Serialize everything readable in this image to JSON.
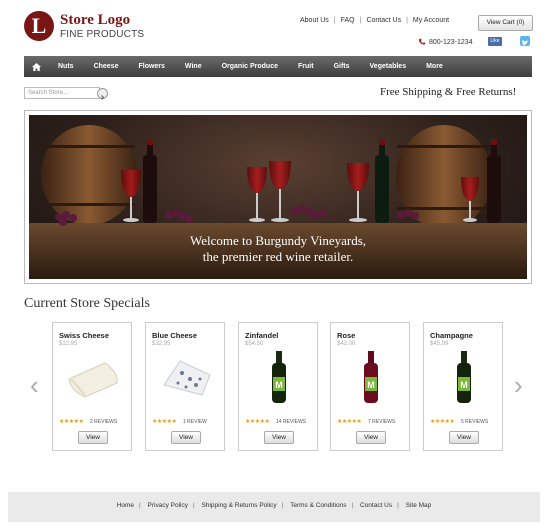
{
  "header": {
    "logo_letter": "L",
    "logo_title": "Store Logo",
    "logo_subtitle": "FINE PRODUCTS",
    "top_links": [
      "About Us",
      "FAQ",
      "Contact Us",
      "My Account"
    ],
    "cart_label": "View Cart (0)",
    "phone": "800-123-1234",
    "like_label": "Like"
  },
  "nav": {
    "home_icon": "home-icon",
    "items": [
      "Nuts",
      "Cheese",
      "Flowers",
      "Wine",
      "Organic Produce",
      "Fruit",
      "Gifts",
      "Vegetables",
      "More"
    ]
  },
  "search": {
    "placeholder": "Search Store..."
  },
  "promo": {
    "free_shipping": "Free Shipping & Free Returns!"
  },
  "banner": {
    "caption_line1": "Welcome to Burgundy Vineyards,",
    "caption_line2": "the premier red wine retailer."
  },
  "specials": {
    "title": "Current Store Specials",
    "prev_arrow": "‹",
    "next_arrow": "›",
    "products": [
      {
        "name": "Swiss Cheese",
        "price": "$12.95",
        "stars": "★★★★★",
        "reviews": "2 REVIEWS",
        "view": "View",
        "image": "swiss-cheese"
      },
      {
        "name": "Blue Cheese",
        "price": "$32.95",
        "stars": "★★★★★",
        "reviews": "1 REVIEW",
        "view": "View",
        "image": "blue-cheese"
      },
      {
        "name": "Zinfandel",
        "price": "$54.50",
        "stars": "★★★★★",
        "reviews": "14 REVIEWS",
        "view": "View",
        "image": "wine-bottle"
      },
      {
        "name": "Rose",
        "price": "$42.00",
        "stars": "★★★★★",
        "reviews": "7 REVIEWS",
        "view": "View",
        "image": "wine-bottle"
      },
      {
        "name": "Champagne",
        "price": "$45.99",
        "stars": "★★★★★",
        "reviews": "5 REVIEWS",
        "view": "View",
        "image": "wine-bottle"
      }
    ]
  },
  "footer": {
    "links": [
      "Home",
      "Privacy Policy",
      "Shipping & Returns Policy",
      "Terms & Conditions",
      "Contact Us",
      "Site Map"
    ]
  },
  "colors": {
    "brand": "#7a1515",
    "nav_bg": "#4a4a4a",
    "star": "#e0a020"
  }
}
